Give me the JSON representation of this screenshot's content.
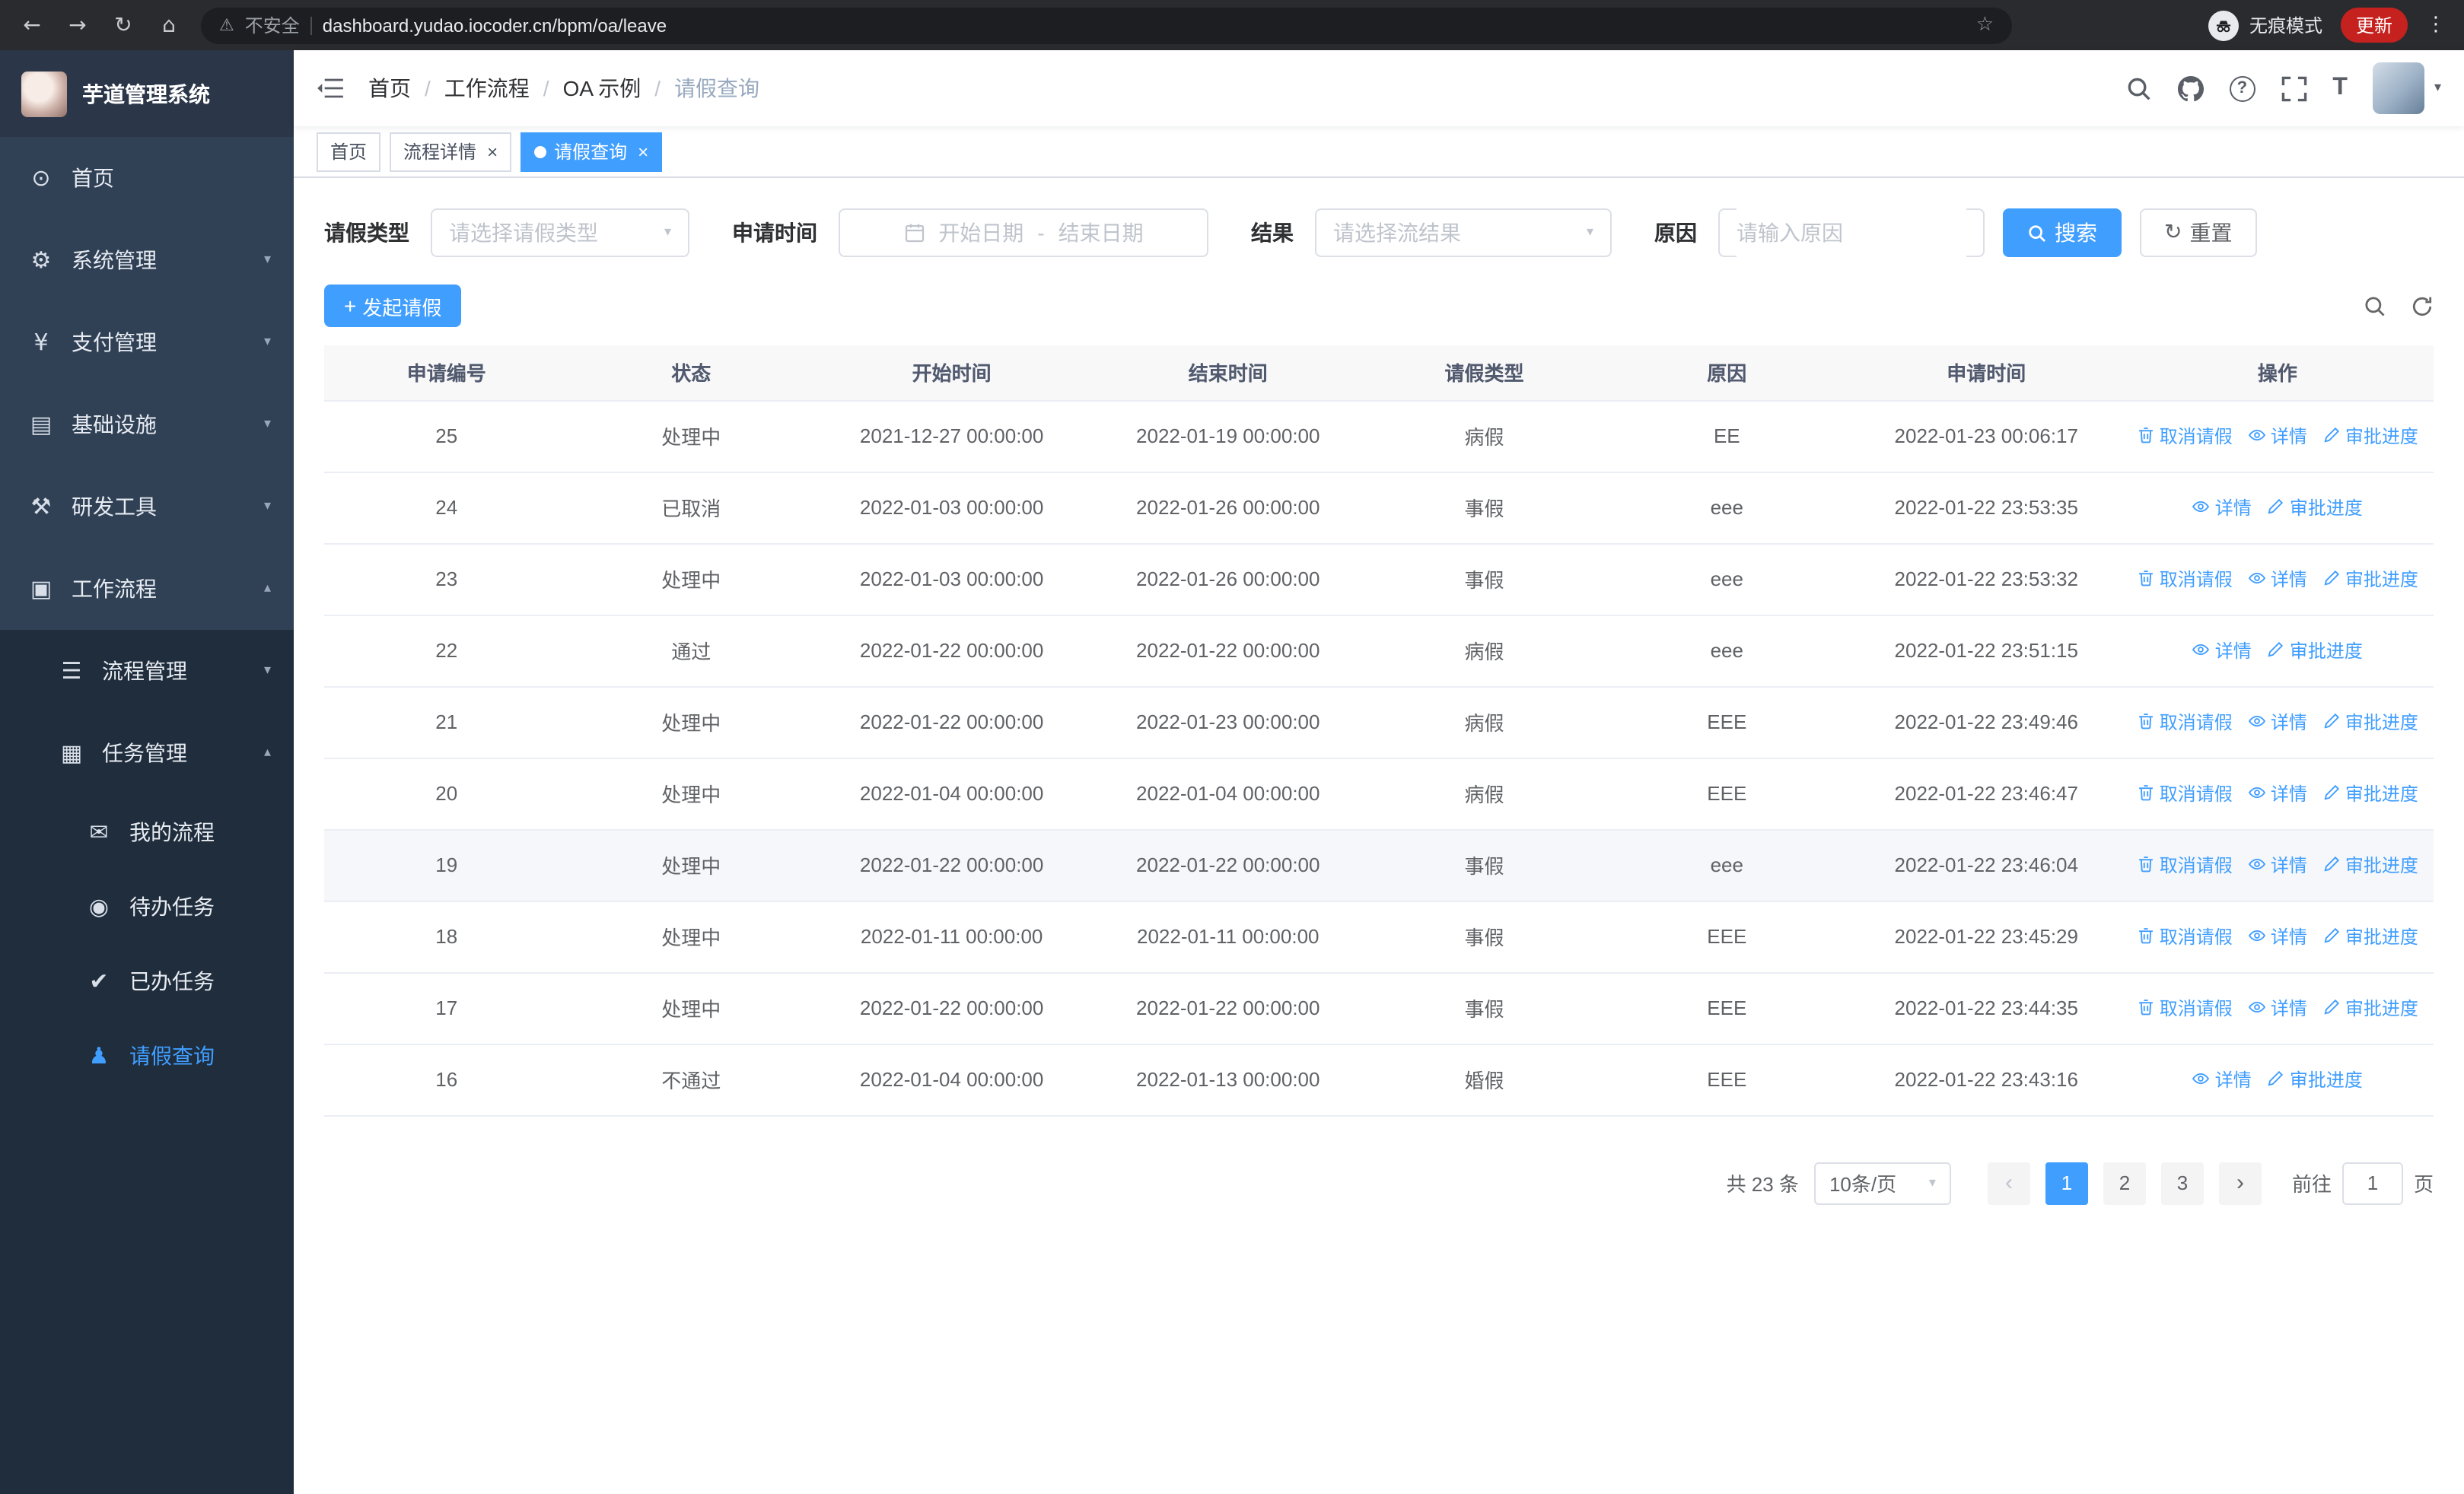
{
  "browser": {
    "back": "←",
    "forward": "→",
    "reload": "↻",
    "home": "⌂",
    "warning": "⚠",
    "security": "不安全",
    "url": "dashboard.yudao.iocoder.cn/bpm/oa/leave",
    "star": "☆",
    "incognito": "无痕模式",
    "update": "更新",
    "kebab": "⋮"
  },
  "ui": {
    "close": "×",
    "select_arrow": "▾",
    "caret": "▾",
    "help": "?",
    "font_icon": "T",
    "prev": "‹",
    "next": "›",
    "plus": "+",
    "reset_icon": "↻"
  },
  "sidebar": {
    "logo_title": "芋道管理系统",
    "items": [
      {
        "label": "首页",
        "glyph": "⊙",
        "arrow": ""
      },
      {
        "label": "系统管理",
        "glyph": "⚙",
        "arrow": "▾"
      },
      {
        "label": "支付管理",
        "glyph": "¥",
        "arrow": "▾"
      },
      {
        "label": "基础设施",
        "glyph": "▤",
        "arrow": "▾"
      },
      {
        "label": "研发工具",
        "glyph": "⚒",
        "arrow": "▾"
      },
      {
        "label": "工作流程",
        "glyph": "▣",
        "arrow": "▴"
      },
      {
        "label": "流程管理",
        "glyph": "☰",
        "arrow": "▾"
      },
      {
        "label": "任务管理",
        "glyph": "▦",
        "arrow": "▴"
      },
      {
        "label": "我的流程",
        "glyph": "✉",
        "arrow": ""
      },
      {
        "label": "待办任务",
        "glyph": "◉",
        "arrow": ""
      },
      {
        "label": "已办任务",
        "glyph": "✔",
        "arrow": ""
      },
      {
        "label": "请假查询",
        "glyph": "♟",
        "arrow": ""
      }
    ]
  },
  "header": {
    "breadcrumb": [
      "首页",
      "工作流程",
      "OA 示例",
      "请假查询"
    ],
    "sep": "/"
  },
  "tabs": [
    {
      "label": "首页"
    },
    {
      "label": "流程详情"
    },
    {
      "label": "请假查询"
    }
  ],
  "filters": {
    "leave_type_label": "请假类型",
    "leave_type_placeholder": "请选择请假类型",
    "apply_time_label": "申请时间",
    "start_date_placeholder": "开始日期",
    "range_separator": "-",
    "end_date_placeholder": "结束日期",
    "result_label": "结果",
    "result_placeholder": "请选择流结果",
    "reason_label": "原因",
    "reason_placeholder": "请输入原因",
    "search_label": "搜索",
    "reset_label": "重置"
  },
  "toolbar": {
    "create_label": "发起请假"
  },
  "table": {
    "columns": [
      "申请编号",
      "状态",
      "开始时间",
      "结束时间",
      "请假类型",
      "原因",
      "申请时间",
      "操作"
    ],
    "action_labels": {
      "cancel": "取消请假",
      "detail": "详情",
      "progress": "审批进度"
    },
    "rows": [
      {
        "id": "25",
        "status": "处理中",
        "start": "2021-12-27 00:00:00",
        "end": "2022-01-19 00:00:00",
        "type": "病假",
        "reason": "EE",
        "applied": "2022-01-23 00:06:17",
        "actions": [
          "cancel",
          "detail",
          "progress"
        ]
      },
      {
        "id": "24",
        "status": "已取消",
        "start": "2022-01-03 00:00:00",
        "end": "2022-01-26 00:00:00",
        "type": "事假",
        "reason": "eee",
        "applied": "2022-01-22 23:53:35",
        "actions": [
          "detail",
          "progress"
        ]
      },
      {
        "id": "23",
        "status": "处理中",
        "start": "2022-01-03 00:00:00",
        "end": "2022-01-26 00:00:00",
        "type": "事假",
        "reason": "eee",
        "applied": "2022-01-22 23:53:32",
        "actions": [
          "cancel",
          "detail",
          "progress"
        ]
      },
      {
        "id": "22",
        "status": "通过",
        "start": "2022-01-22 00:00:00",
        "end": "2022-01-22 00:00:00",
        "type": "病假",
        "reason": "eee",
        "applied": "2022-01-22 23:51:15",
        "actions": [
          "detail",
          "progress"
        ]
      },
      {
        "id": "21",
        "status": "处理中",
        "start": "2022-01-22 00:00:00",
        "end": "2022-01-23 00:00:00",
        "type": "病假",
        "reason": "EEE",
        "applied": "2022-01-22 23:49:46",
        "actions": [
          "cancel",
          "detail",
          "progress"
        ]
      },
      {
        "id": "20",
        "status": "处理中",
        "start": "2022-01-04 00:00:00",
        "end": "2022-01-04 00:00:00",
        "type": "病假",
        "reason": "EEE",
        "applied": "2022-01-22 23:46:47",
        "actions": [
          "cancel",
          "detail",
          "progress"
        ]
      },
      {
        "id": "19",
        "status": "处理中",
        "start": "2022-01-22 00:00:00",
        "end": "2022-01-22 00:00:00",
        "type": "事假",
        "reason": "eee",
        "applied": "2022-01-22 23:46:04",
        "actions": [
          "cancel",
          "detail",
          "progress"
        ],
        "hover": true
      },
      {
        "id": "18",
        "status": "处理中",
        "start": "2022-01-11 00:00:00",
        "end": "2022-01-11 00:00:00",
        "type": "事假",
        "reason": "EEE",
        "applied": "2022-01-22 23:45:29",
        "actions": [
          "cancel",
          "detail",
          "progress"
        ]
      },
      {
        "id": "17",
        "status": "处理中",
        "start": "2022-01-22 00:00:00",
        "end": "2022-01-22 00:00:00",
        "type": "事假",
        "reason": "EEE",
        "applied": "2022-01-22 23:44:35",
        "actions": [
          "cancel",
          "detail",
          "progress"
        ]
      },
      {
        "id": "16",
        "status": "不通过",
        "start": "2022-01-04 00:00:00",
        "end": "2022-01-13 00:00:00",
        "type": "婚假",
        "reason": "EEE",
        "applied": "2022-01-22 23:43:16",
        "actions": [
          "detail",
          "progress"
        ]
      }
    ]
  },
  "pagination": {
    "total": "共 23 条",
    "page_size": "10条/页",
    "pages": [
      "1",
      "2",
      "3"
    ],
    "goto_label": "前往",
    "goto_value": "1",
    "page_unit": "页"
  },
  "colors": {
    "primary": "#409eff",
    "sidebar": "#304156",
    "sidebar_dark": "#1f2d3d"
  }
}
